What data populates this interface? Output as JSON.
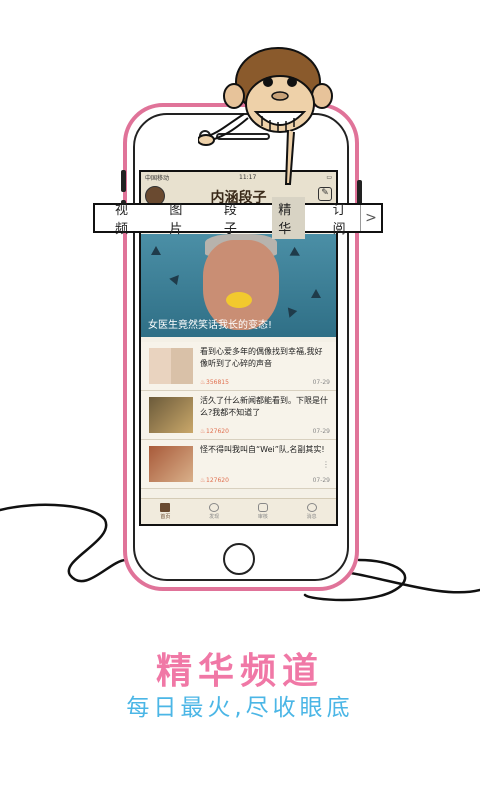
{
  "status_bar": {
    "carrier": "中国移动",
    "time": "11:17"
  },
  "app": {
    "title": "内涵段子"
  },
  "categories": {
    "items": [
      {
        "label": "视频"
      },
      {
        "label": "图片"
      },
      {
        "label": "段子"
      },
      {
        "label": "精华"
      },
      {
        "label": "订阅"
      }
    ],
    "active": "精华",
    "more_icon": ">"
  },
  "hero": {
    "caption": "女医生竟然笑话我长的变态!"
  },
  "feed": [
    {
      "text": "看到心爱多年的偶像找到幸福,我好像听到了心碎的声音",
      "count": "356815",
      "date": "07-29"
    },
    {
      "text": "活久了什么新闻都能看到。下限是什么?我都不知道了",
      "count": "127620",
      "date": "07-29"
    },
    {
      "text": "怪不得叫我叫自“Wei”队,名副其实!",
      "count": "127620",
      "date": "07-29"
    }
  ],
  "tabbar": [
    {
      "label": "首页",
      "icon": "home-icon"
    },
    {
      "label": "发现",
      "icon": "compass-icon"
    },
    {
      "label": "审核",
      "icon": "check-icon"
    },
    {
      "label": "消息",
      "icon": "message-icon"
    }
  ],
  "tagline": {
    "main": "精华频道",
    "sub": "每日最火,尽收眼底"
  },
  "colors": {
    "phone_frame": "#e07399",
    "tagline_main": "#f078a6",
    "tagline_sub": "#4bb6e6"
  }
}
